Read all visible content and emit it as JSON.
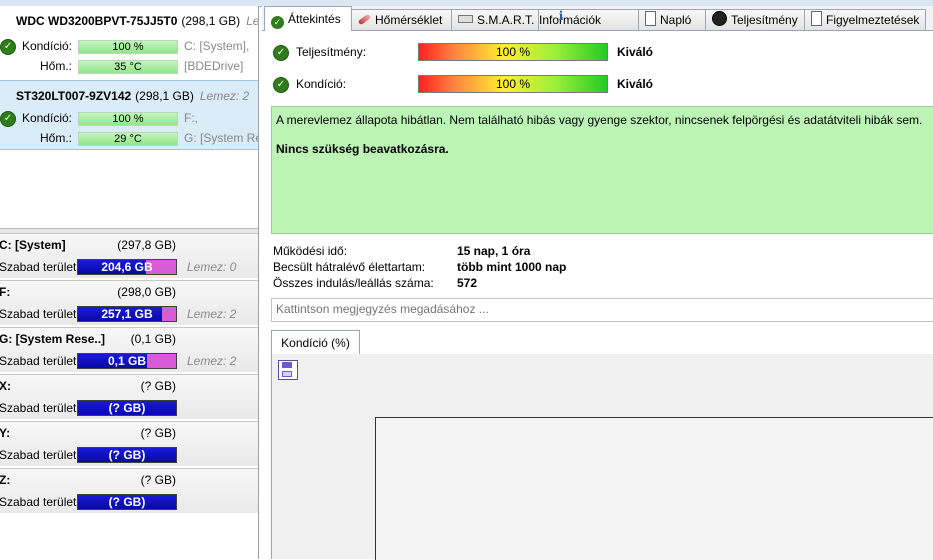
{
  "disks": [
    {
      "model": "WDC WD3200BPVT-75JJ5T0",
      "size": "(298,1 GB)",
      "extra": "Lem",
      "rows": [
        {
          "label": "Kondíció:",
          "value": "100 %",
          "side": "C: [System],"
        },
        {
          "label": "Hőm.:",
          "value": "35 °C",
          "side": "[BDEDrive]"
        }
      ]
    },
    {
      "model": "ST320LT007-9ZV142",
      "size": "(298,1 GB)",
      "extra": "Lemez: 2",
      "rows": [
        {
          "label": "Kondíció:",
          "value": "100 %",
          "side": "F:,"
        },
        {
          "label": "Hőm.:",
          "value": "29 °C",
          "side": "G: [System Re"
        }
      ]
    }
  ],
  "volumes": [
    {
      "name": "C: [System]",
      "size": "(297,8 GB)",
      "free_label": "Szabad terület",
      "free": "204,6 GB",
      "free_fraction": 0.69,
      "disk": "Lemez: 0"
    },
    {
      "name": "F:",
      "size": "(298,0 GB)",
      "free_label": "Szabad terület",
      "free": "257,1 GB",
      "free_fraction": 0.86,
      "disk": "Lemez: 2"
    },
    {
      "name": "G: [System Rese..]",
      "size": "(0,1 GB)",
      "free_label": "Szabad terület",
      "free": "0,1 GB",
      "free_fraction": 0.7,
      "disk": "Lemez: 2"
    },
    {
      "name": "X:",
      "size": "(? GB)",
      "free_label": "Szabad terület",
      "free": "(? GB)",
      "free_fraction": 1.0,
      "disk": ""
    },
    {
      "name": "Y:",
      "size": "(? GB)",
      "free_label": "Szabad terület",
      "free": "(? GB)",
      "free_fraction": 1.0,
      "disk": ""
    },
    {
      "name": "Z:",
      "size": "(? GB)",
      "free_label": "Szabad terület",
      "free": "(? GB)",
      "free_fraction": 1.0,
      "disk": ""
    }
  ],
  "tabs": [
    {
      "label": "Áttekintés",
      "icon": "check-circle-icon",
      "active": true
    },
    {
      "label": "Hőmérséklet",
      "icon": "thermometer-icon"
    },
    {
      "label": "S.M.A.R.T.",
      "icon": "smart-icon"
    },
    {
      "label": "Információk",
      "icon": "info-icon"
    },
    {
      "label": "Napló",
      "icon": "log-icon"
    },
    {
      "label": "Teljesítmény",
      "icon": "gauge-icon"
    },
    {
      "label": "Figyelmeztetések",
      "icon": "warning-doc-icon"
    }
  ],
  "overview": {
    "performance": {
      "label": "Teljesítmény:",
      "value": "100 %",
      "rating": "Kiváló"
    },
    "health": {
      "label": "Kondíció:",
      "value": "100 %",
      "rating": "Kiváló"
    },
    "status_line1": "A merevlemez állapota hibátlan. Nem található hibás vagy gyenge szektor, nincsenek felpörgési és adatátviteli hibák sem.",
    "status_line2": "Nincs szükség beavatkozásra.",
    "uptime_label": "Működési idő:",
    "uptime_value": "15 nap, 1 óra",
    "lifetime_label": "Becsült hátralévő élettartam:",
    "lifetime_value": "több mint 1000 nap",
    "startstop_label": "Összes indulás/leállás száma:",
    "startstop_value": "572",
    "note_placeholder": "Kattintson megjegyzés megadásához ..."
  },
  "chart_tab": {
    "label": "Kondíció  (%)"
  },
  "colors": {
    "ok_green": "#2f7d1a",
    "status_bg": "#bbf4b4",
    "free_bar": "#0909a8",
    "used_bar": "#d75cd6"
  }
}
